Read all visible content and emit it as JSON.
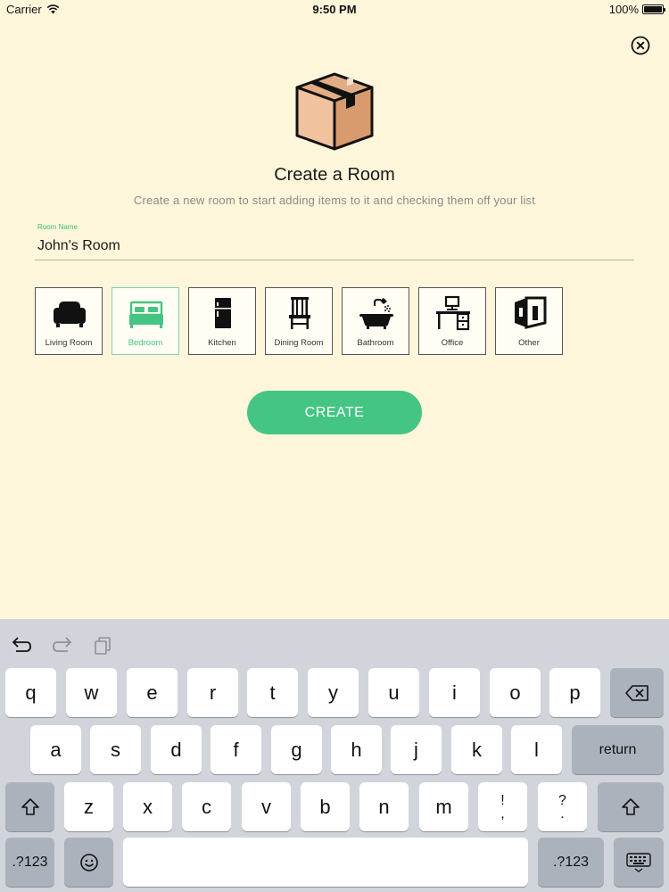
{
  "status_bar": {
    "carrier": "Carrier",
    "time": "9:50 PM",
    "battery": "100%"
  },
  "header": {
    "title": "Create a Room",
    "subtitle": "Create a new room to start adding items to it and checking them off your list"
  },
  "room_name": {
    "label": "Room Name",
    "value": "John's Room"
  },
  "room_types": [
    {
      "label": "Living Room",
      "icon": "armchair-icon",
      "selected": false
    },
    {
      "label": "Bedroom",
      "icon": "bed-icon",
      "selected": true
    },
    {
      "label": "Kitchen",
      "icon": "refrigerator-icon",
      "selected": false
    },
    {
      "label": "Dining Room",
      "icon": "dining-chair-icon",
      "selected": false
    },
    {
      "label": "Bathroom",
      "icon": "bathtub-icon",
      "selected": false
    },
    {
      "label": "Office",
      "icon": "desk-icon",
      "selected": false
    },
    {
      "label": "Other",
      "icon": "room-icon",
      "selected": false
    }
  ],
  "create_button": {
    "label": "CREATE"
  },
  "colors": {
    "background": "#fef6db",
    "accent": "#45c584",
    "selected_label": "#46c483"
  },
  "keyboard": {
    "row1": [
      "q",
      "w",
      "e",
      "r",
      "t",
      "y",
      "u",
      "i",
      "o",
      "p"
    ],
    "row2": [
      "a",
      "s",
      "d",
      "f",
      "g",
      "h",
      "j",
      "k",
      "l"
    ],
    "row3": [
      "z",
      "x",
      "c",
      "v",
      "b",
      "n",
      "m"
    ],
    "punct1": {
      "top": "!",
      "bottom": ","
    },
    "punct2": {
      "top": "?",
      "bottom": "."
    },
    "return_label": "return",
    "numbers_label": ".?123",
    "numbers_label_right": ".?123"
  }
}
